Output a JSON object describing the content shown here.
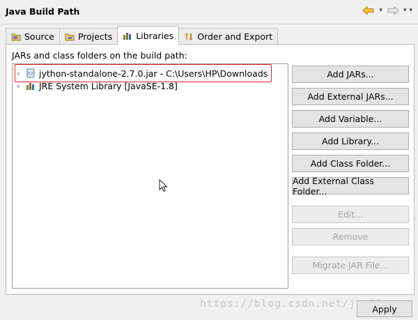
{
  "window": {
    "title": "Java Build Path"
  },
  "nav": {
    "back_icon": "yellow-back-arrow-icon",
    "forward_icon": "forward-arrow-icon",
    "menu_glyph": "▾"
  },
  "tabs": [
    {
      "label": "Source",
      "icon": "source-folder-icon",
      "active": false
    },
    {
      "label": "Projects",
      "icon": "projects-icon",
      "active": false
    },
    {
      "label": "Libraries",
      "icon": "libraries-icon",
      "active": true
    },
    {
      "label": "Order and Export",
      "icon": "order-export-icon",
      "active": false
    }
  ],
  "libraries": {
    "heading": "JARs and class folders on the build path:",
    "entries": [
      {
        "label": "jython-standalone-2.7.0.jar - C:\\Users\\HP\\Downloads",
        "icon": "jar-file-icon",
        "expand_glyph": "›",
        "highlighted": true
      },
      {
        "label": "JRE System Library [JavaSE-1.8]",
        "icon": "jre-library-icon",
        "expand_glyph": "›",
        "highlighted": false
      }
    ]
  },
  "buttons": {
    "add_jars": "Add JARs...",
    "add_external_jars": "Add External JARs...",
    "add_variable": "Add Variable...",
    "add_library": "Add Library...",
    "add_class_folder": "Add Class Folder...",
    "add_external_class_folder": "Add External Class Folder...",
    "edit": "Edit...",
    "remove": "Remove",
    "migrate_jar": "Migrate JAR File..."
  },
  "footer": {
    "watermark": "https://blog.csdn.net/jc  01",
    "apply": "Apply"
  },
  "colors": {
    "highlight_border": "#d22222",
    "disabled_text": "#a6a6a6"
  }
}
